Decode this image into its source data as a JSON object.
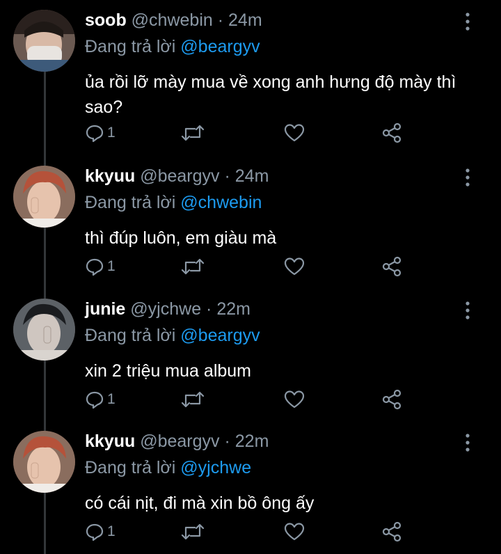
{
  "reply_prefix": "Đang trả lời",
  "colors": {
    "background": "#000000",
    "muted": "#8b98a5",
    "mention": "#1d9bf0",
    "text": "#ffffff"
  },
  "tweets": [
    {
      "name": "soob",
      "handle": "@chwebin",
      "time": "24m",
      "reply_to": "@beargyv",
      "text": "ủa rồi lỡ mày mua về xong anh hưng độ mày thì sao?",
      "reply_count": "1"
    },
    {
      "name": "kkyuu",
      "handle": "@beargyv",
      "time": "24m",
      "reply_to": "@chwebin",
      "text": "thì đúp luôn, em giàu mà",
      "reply_count": "1"
    },
    {
      "name": "junie",
      "handle": "@yjchwe",
      "time": "22m",
      "reply_to": "@beargyv",
      "text": "xin 2 triệu mua album",
      "reply_count": "1"
    },
    {
      "name": "kkyuu",
      "handle": "@beargyv",
      "time": "22m",
      "reply_to": "@yjchwe",
      "text": "có cái nịt, đi mà xin bồ ông ấy",
      "reply_count": "1"
    }
  ]
}
